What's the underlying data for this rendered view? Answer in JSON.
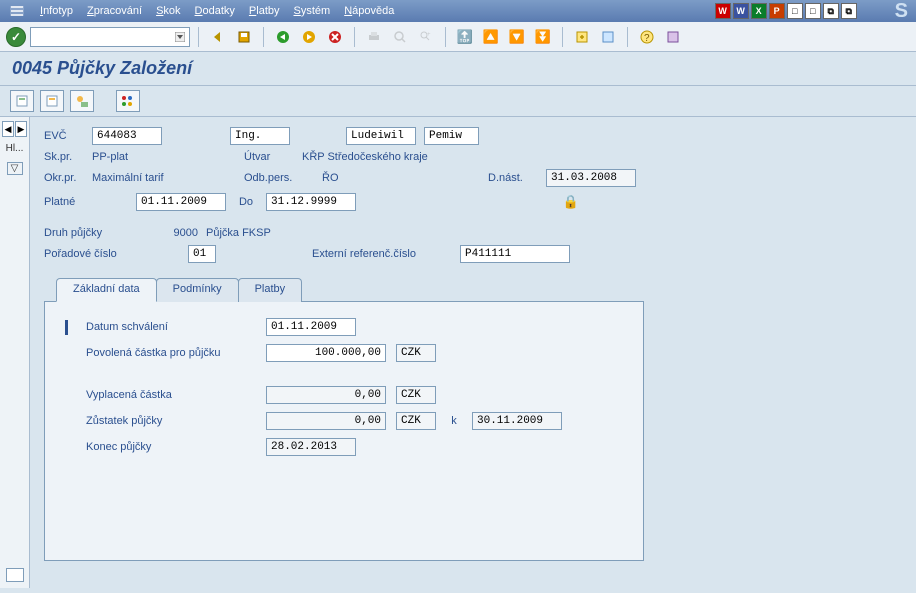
{
  "menu": {
    "items": [
      {
        "label": "Infotyp",
        "u": "I",
        "rest": "nfotyp"
      },
      {
        "label": "Zpracování",
        "u": "Z",
        "rest": "pracování"
      },
      {
        "label": "Skok",
        "u": "S",
        "rest": "kok"
      },
      {
        "label": "Dodatky",
        "u": "D",
        "rest": "odatky"
      },
      {
        "label": "Platby",
        "u": "P",
        "rest": "latby"
      },
      {
        "label": "Systém",
        "u": "S",
        "rest": "ystém"
      },
      {
        "label": "Nápověda",
        "u": "N",
        "rest": "ápověda"
      }
    ],
    "right_icons": [
      "W",
      "W",
      "X",
      "P",
      "□",
      "□",
      "⧉",
      "⧉"
    ]
  },
  "title": "0045 Půjčky Založení",
  "sidebar": {
    "hl": "Hl...",
    "expand": "▽"
  },
  "header": {
    "evc_label": "EVČ",
    "evc_value": "644083",
    "deg": "Ing.",
    "name1": "Ludeiwil",
    "name2": "Pemiw",
    "skpr_label": "Sk.pr.",
    "skpr_value": "PP-plat",
    "utvar_label": "Útvar",
    "utvar_value": "KŘP Středočeského kraje",
    "okrpr_label": "Okr.pr.",
    "okrpr_value": "Maximální tarif",
    "odbpers_label": "Odb.pers.",
    "odbpers_value": "ŘO",
    "dnast_label": "D.nást.",
    "dnast_value": "31.03.2008",
    "platne_label": "Platné",
    "platne_from": "01.11.2009",
    "do_label": "Do",
    "platne_to": "31.12.9999"
  },
  "loan": {
    "druh_label": "Druh půjčky",
    "druh_code": "9000",
    "druh_text": "Půjčka FKSP",
    "por_label": "Pořadové číslo",
    "por_value": "01",
    "extref_label": "Externí referenč.číslo",
    "extref_value": "P411111"
  },
  "tabs": [
    "Základní data",
    "Podmínky",
    "Platby"
  ],
  "basic": {
    "datum_label": "Datum schválení",
    "datum_value": "01.11.2009",
    "povolena_label": "Povolená částka pro půjčku",
    "povolena_value": "100.000,00",
    "povolena_cur": "CZK",
    "vyplacena_label": "Vyplacená částka",
    "vyplacena_value": "0,00",
    "vyplacena_cur": "CZK",
    "zustatek_label": "Zůstatek půjčky",
    "zustatek_value": "0,00",
    "zustatek_cur": "CZK",
    "k_label": "k",
    "k_value": "30.11.2009",
    "konec_label": "Konec půjčky",
    "konec_value": "28.02.2013"
  }
}
